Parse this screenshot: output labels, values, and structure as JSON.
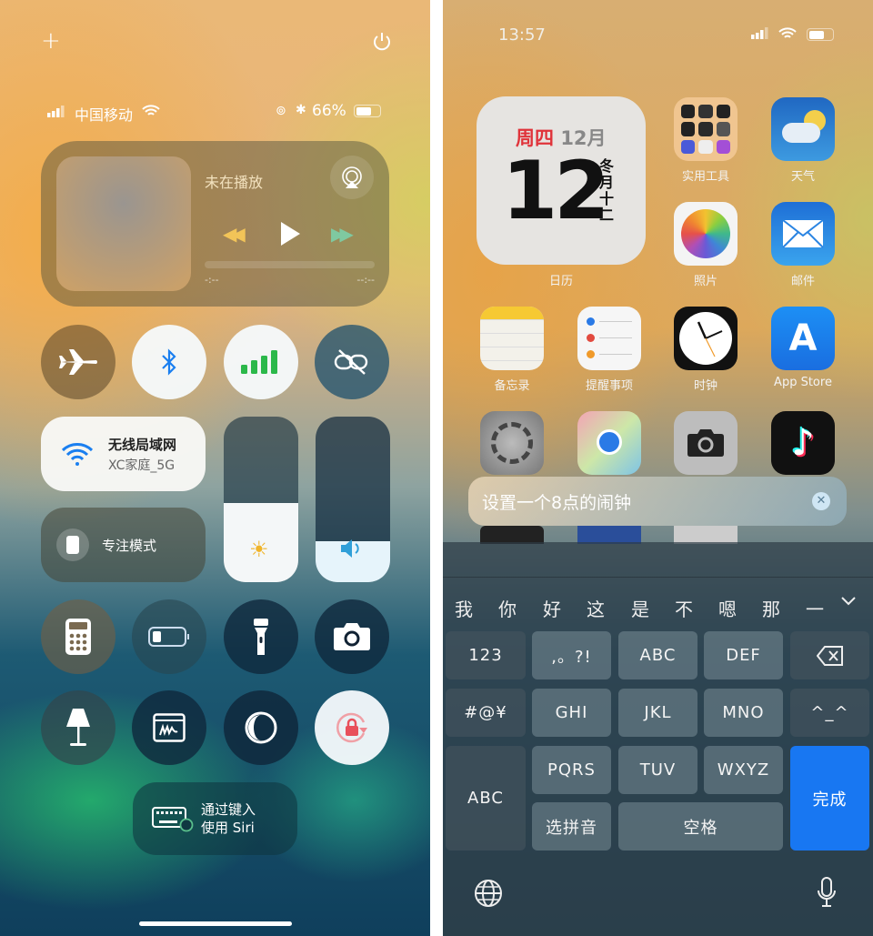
{
  "left": {
    "status": {
      "carrier": "中国移动",
      "battery": "66%",
      "battery_level": 0.66
    },
    "media": {
      "title": "未在播放",
      "elapsed": "-:--",
      "remaining": "--:--",
      "progress": 0
    },
    "wifi": {
      "title": "无线局域网",
      "network": "XC家庭_5G"
    },
    "focus": {
      "label": "专注模式"
    },
    "brightness_level": 0.48,
    "volume_level": 0.25,
    "siri": {
      "line1": "通过键入",
      "line2": "使用 Siri"
    },
    "colors": {
      "bluetooth": "#1a7ff0",
      "cellular": "#2bb84a",
      "lock": "#e8505b"
    }
  },
  "right": {
    "status": {
      "time": "13:57"
    },
    "calendar": {
      "weekday": "周四",
      "month": "12月",
      "day": "12",
      "lunar": [
        "冬",
        "月",
        "十",
        "二"
      ],
      "label": "日历"
    },
    "apps": [
      {
        "label": "实用工具"
      },
      {
        "label": "天气"
      },
      {
        "label": "照片"
      },
      {
        "label": "邮件"
      },
      {
        "label": "备忘录"
      },
      {
        "label": "提醒事项"
      },
      {
        "label": "时钟"
      },
      {
        "label": "App Store"
      }
    ],
    "search": {
      "value": "设置一个8点的闹钟"
    },
    "candidates": [
      "我",
      "你",
      "好",
      "这",
      "是",
      "不",
      "嗯",
      "那",
      "一"
    ],
    "keys": {
      "num": "123",
      "punct": ",。?!",
      "abc": "ABC",
      "def": "DEF",
      "sym": "#@¥",
      "ghi": "GHI",
      "jkl": "JKL",
      "mno": "MNO",
      "emoji": "^_^",
      "abc_mode": "ABC",
      "pqrs": "PQRS",
      "tuv": "TUV",
      "wxyz": "WXYZ",
      "pinyin": "选拼音",
      "space": "空格",
      "done": "完成"
    },
    "colors": {
      "done": "#1877f2",
      "weekday": "#e0333a"
    }
  }
}
